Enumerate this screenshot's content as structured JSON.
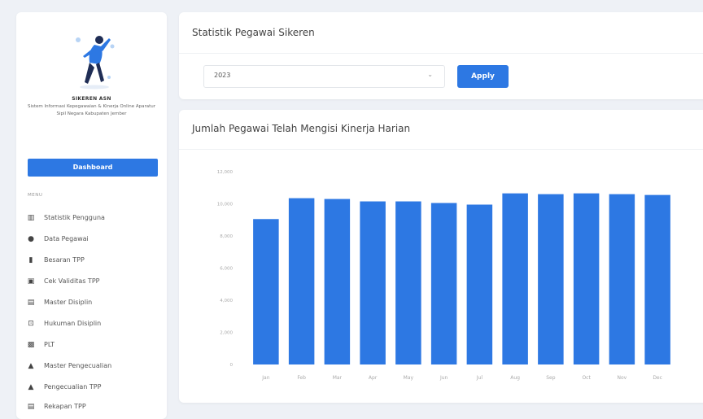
{
  "sidebar": {
    "brand_title": "SIKEREN ASN",
    "brand_subtitle": "Sistem Informasi Kepegawaian & Kinerja Online Aparatur Sipil Negara Kabupaten Jember",
    "dashboard_label": "Dashboard",
    "menu_label": "MENU",
    "items": [
      {
        "label": "Statistik Pengguna",
        "icon": "bar-chart-icon"
      },
      {
        "label": "Data Pegawai",
        "icon": "user-circle-icon"
      },
      {
        "label": "Besaran TPP",
        "icon": "document-icon"
      },
      {
        "label": "Cek Validitas TPP",
        "icon": "check-square-icon"
      },
      {
        "label": "Master Disiplin",
        "icon": "monitor-icon"
      },
      {
        "label": "Hukuman Disiplin",
        "icon": "gavel-icon"
      },
      {
        "label": "PLT",
        "icon": "briefcase-icon"
      },
      {
        "label": "Master Pengecualian",
        "icon": "warning-icon"
      },
      {
        "label": "Pengecualian TPP",
        "icon": "warning-icon"
      },
      {
        "label": "Rekapan TPP",
        "icon": "document-icon"
      }
    ]
  },
  "header": {
    "title": "Statistik Pegawai Sikeren"
  },
  "filter": {
    "year": "2023",
    "apply_label": "Apply"
  },
  "chart_card": {
    "title": "Jumlah Pegawai Telah Mengisi Kinerja Harian"
  },
  "colors": {
    "accent": "#2d78e3"
  },
  "chart_data": {
    "type": "bar",
    "categories": [
      "Jan",
      "Feb",
      "Mar",
      "Apr",
      "May",
      "Jun",
      "Jul",
      "Aug",
      "Sep",
      "Oct",
      "Nov",
      "Dec"
    ],
    "values": [
      9050,
      10350,
      10300,
      10150,
      10150,
      10050,
      9950,
      10650,
      10600,
      10650,
      10600,
      10550
    ],
    "y_ticks": [
      "0",
      "2,000",
      "4,000",
      "6,000",
      "8,000",
      "10,000",
      "12,000"
    ],
    "ylim": [
      0,
      12000
    ],
    "title": "Jumlah Pegawai Telah Mengisi Kinerja Harian",
    "xlabel": "",
    "ylabel": "",
    "grid": false,
    "color": "#2d78e3"
  }
}
